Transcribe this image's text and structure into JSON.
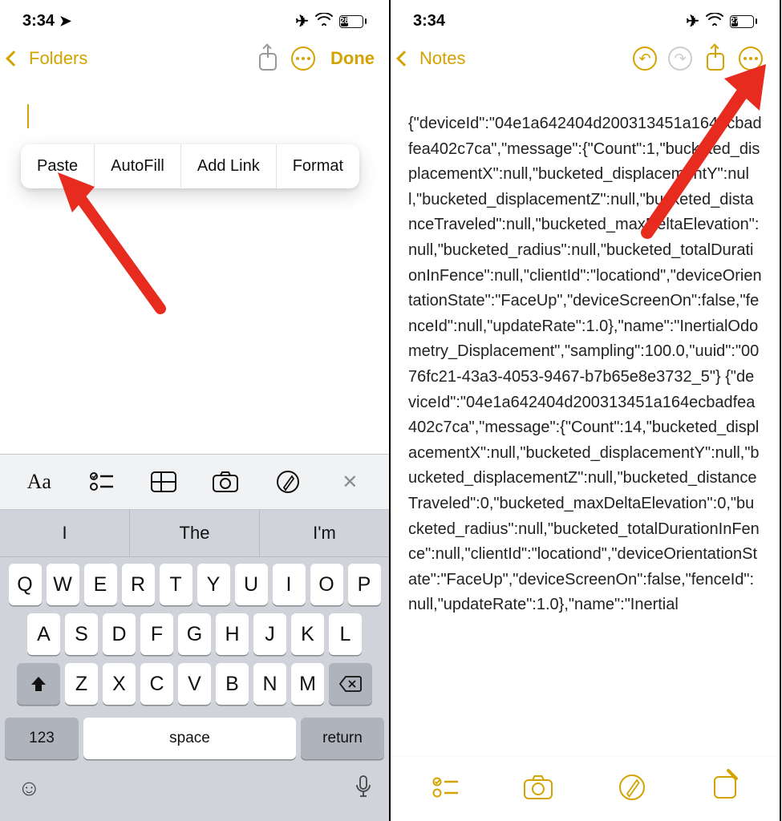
{
  "left": {
    "status": {
      "time": "3:34",
      "battery_pct": "28"
    },
    "nav": {
      "back_label": "Folders",
      "done_label": "Done"
    },
    "context_menu": [
      "Paste",
      "AutoFill",
      "Add Link",
      "Format"
    ],
    "keyboard": {
      "tools": [
        "Aa",
        "checklist",
        "table",
        "camera",
        "markup",
        "close"
      ],
      "suggestions": [
        "I",
        "The",
        "I'm"
      ],
      "row1": [
        "Q",
        "W",
        "E",
        "R",
        "T",
        "Y",
        "U",
        "I",
        "O",
        "P"
      ],
      "row2": [
        "A",
        "S",
        "D",
        "F",
        "G",
        "H",
        "J",
        "K",
        "L"
      ],
      "row3": [
        "Z",
        "X",
        "C",
        "V",
        "B",
        "N",
        "M"
      ],
      "num_label": "123",
      "space_label": "space",
      "return_label": "return"
    }
  },
  "right": {
    "status": {
      "time": "3:34",
      "battery_pct": "27"
    },
    "nav": {
      "back_label": "Notes"
    },
    "note_text": "{\"deviceId\":\"04e1a642404d200313451a164ecbadfea402c7ca\",\"message\":{\"Count\":1,\"bucketed_displacementX\":null,\"bucketed_displacementY\":null,\"bucketed_displacementZ\":null,\"bucketed_distanceTraveled\":null,\"bucketed_maxDeltaElevation\":null,\"bucketed_radius\":null,\"bucketed_totalDurationInFence\":null,\"clientId\":\"locationd\",\"deviceOrientationState\":\"FaceUp\",\"deviceScreenOn\":false,\"fenceId\":null,\"updateRate\":1.0},\"name\":\"InertialOdometry_Displacement\",\"sampling\":100.0,\"uuid\":\"0076fc21-43a3-4053-9467-b7b65e8e3732_5\"}\n{\"deviceId\":\"04e1a642404d200313451a164ecbadfea402c7ca\",\"message\":{\"Count\":14,\"bucketed_displacementX\":null,\"bucketed_displacementY\":null,\"bucketed_displacementZ\":null,\"bucketed_distanceTraveled\":0,\"bucketed_maxDeltaElevation\":0,\"bucketed_radius\":null,\"bucketed_totalDurationInFence\":null,\"clientId\":\"locationd\",\"deviceOrientationState\":\"FaceUp\",\"deviceScreenOn\":false,\"fenceId\":null,\"updateRate\":1.0},\"name\":\"Inertial"
  },
  "colors": {
    "accent": "#d4a300",
    "arrow": "#e82b1f"
  }
}
